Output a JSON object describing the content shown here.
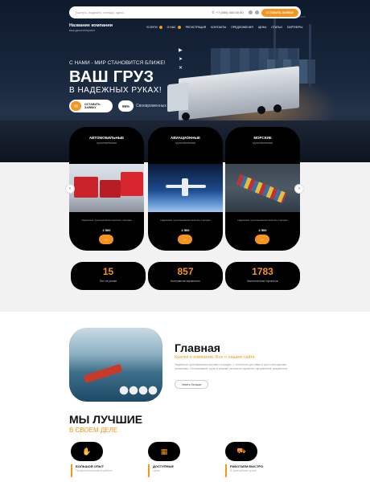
{
  "header": {
    "search_placeholder": "Быстро, надежно, отсюда, здесь",
    "phone": "+7 (000) 000 00 00",
    "cta_label": "ОСТАВИТЬ ЗАЯВКУ",
    "company_name": "Название компании",
    "company_tagline": "ваш десктоп/проект",
    "nav": [
      "УСЛУГИ",
      "О НАС",
      "РЕГИСТРАЦИЯ",
      "КОНТАКТЫ",
      "ПРЕДЛОЖЕНИЯ",
      "ЦЕНЫ",
      "СТАТЬИ",
      "ПАРТНЕРЫ"
    ]
  },
  "hero": {
    "kicker": "С НАМИ - МИР СТАНОВИТСЯ БЛИЖЕ!",
    "title": "ВАШ ГРУЗ",
    "subtitle": "В НАДЕЖНЫХ РУКАХ!",
    "apply_label_1": "ОСТАВИТЬ",
    "apply_label_2": "ЗАЯВКУ",
    "percent": "99%",
    "percent_note": "Своевременных доставок"
  },
  "services": [
    {
      "title": "АВТОМОБИЛЬНЫЕ",
      "subtitle": "грузоперевозки",
      "desc": "Надёжные грузоперевозки высшего порядка",
      "price": "2 500",
      "go": "→"
    },
    {
      "title": "АВИАЦИОННЫЕ",
      "subtitle": "грузоперевозки",
      "desc": "Надёжные грузоперевозки высшего порядка",
      "price": "2 500",
      "go": "→"
    },
    {
      "title": "МОРСКИЕ",
      "subtitle": "грузоперевозки",
      "desc": "Надёжные грузоперевозки высшего порядка",
      "price": "2 500",
      "go": "→"
    }
  ],
  "slider": {
    "prev": "‹",
    "next": "›"
  },
  "stats": [
    {
      "num": "15",
      "label": "Лет на рынке"
    },
    {
      "num": "857",
      "label": "Контрактов заключено"
    },
    {
      "num": "1783",
      "label": "Выполненных проектов"
    }
  ],
  "about": {
    "title": "Главная",
    "subtitle": "Кратко о компании. Все о нашем сайте",
    "text": "Надёжные грузоперевозки высшего порядка. С точностью доставки в срок и выгодными условиями. Отслеживание груза в режиме реального времени, оформление документов.",
    "button": "Узнать больше"
  },
  "best": {
    "title": "МЫ ЛУЧШИЕ",
    "subtitle": "В СВОЕМ ДЕЛЕ",
    "features": [
      {
        "icon": "handshake-icon",
        "glyph": "✋",
        "title": "БОЛЬШОЙ ОПЫТ",
        "sub": "Профессионализм в работе"
      },
      {
        "icon": "calculator-icon",
        "glyph": "▦",
        "title": "ДОСТУПНЫЕ",
        "sub": "Цены"
      },
      {
        "icon": "truck-icon",
        "glyph": "⛟",
        "title": "РАБОТАЕМ БЫСТРО",
        "sub": "В кратчайшие сроки"
      }
    ]
  },
  "colors": {
    "accent": "#f7941d",
    "dark": "#000000",
    "band": "#f2f2f2"
  }
}
